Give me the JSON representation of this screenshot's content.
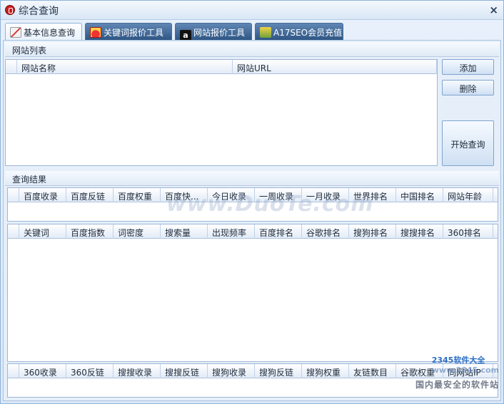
{
  "window": {
    "title": "综合查询",
    "close_glyph": "×"
  },
  "tabs": [
    {
      "label": "基本信息查询",
      "icon": "pen-icon",
      "active": true
    },
    {
      "label": "关键词报价工具",
      "icon": "hat-icon",
      "active": false
    },
    {
      "label": "网站报价工具",
      "icon": "letter-a-icon",
      "active": false
    },
    {
      "label": "A17SEO会员充值",
      "icon": "user-icon",
      "active": false
    }
  ],
  "website_list": {
    "title": "网站列表",
    "columns": [
      "网站名称",
      "网站URL"
    ],
    "add_label": "添加",
    "delete_label": "删除",
    "start_label": "开始查询"
  },
  "results": {
    "title": "查询结果",
    "grid1_columns": [
      "百度收录",
      "百度反链",
      "百度权重",
      "百度快...",
      "今日收录",
      "一周收录",
      "一月收录",
      "世界排名",
      "中国排名",
      "网站年龄"
    ],
    "grid2_columns": [
      "关键词",
      "百度指数",
      "词密度",
      "搜索量",
      "出现频率",
      "百度排名",
      "谷歌排名",
      "搜狗排名",
      "搜搜排名",
      "360排名"
    ],
    "grid3_columns": [
      "360收录",
      "360反链",
      "搜搜收录",
      "搜搜反链",
      "搜狗收录",
      "搜狗反链",
      "搜狗权重",
      "友链数目",
      "谷歌权重",
      "同网站IP"
    ]
  },
  "watermark": "www.DuoTe.com",
  "corner_logo": {
    "main": "2345软件大全",
    "sub": "www.2345.com"
  },
  "corner_text": "国内最安全的软件站"
}
